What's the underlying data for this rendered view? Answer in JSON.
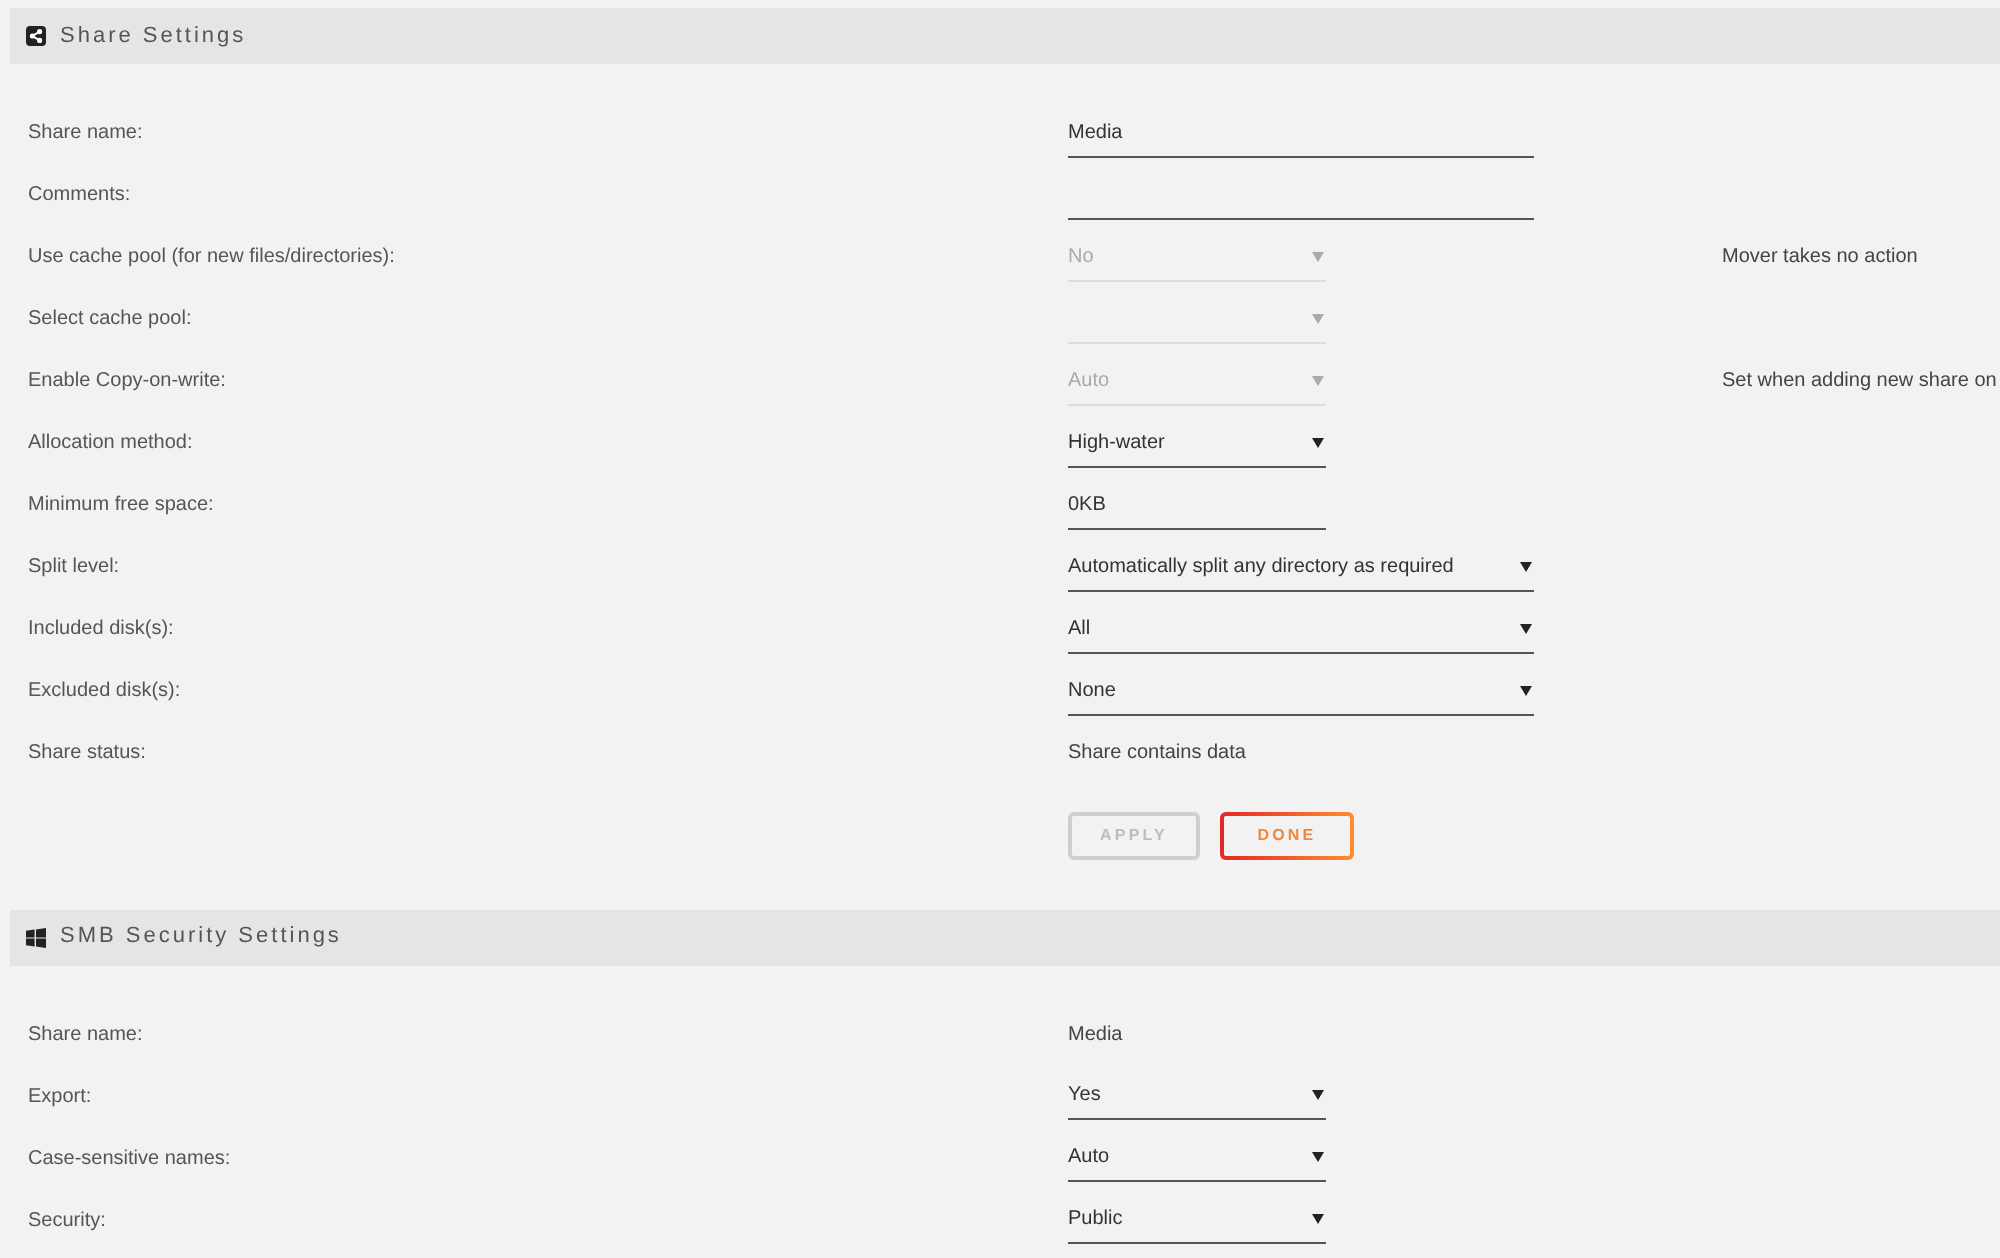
{
  "sections": [
    {
      "kind": "share",
      "title": "Share Settings",
      "rows": [
        {
          "label": "Share name:",
          "field": {
            "kind": "text",
            "value": "Media",
            "wide": true
          }
        },
        {
          "label": "Comments:",
          "field": {
            "kind": "text",
            "wide": true
          }
        },
        {
          "label": "Use cache pool (for new files/directories):",
          "field": {
            "kind": "select",
            "value": "No",
            "disabled": true,
            "wide": false
          },
          "note": "Mover takes no action"
        },
        {
          "label": "Select cache pool:",
          "field": {
            "kind": "select",
            "disabled": true,
            "wide": false
          }
        },
        {
          "label": "Enable Copy-on-write:",
          "field": {
            "kind": "select",
            "value": "Auto",
            "disabled": true,
            "wide": false
          },
          "note": "Set when adding new share on"
        },
        {
          "label": "Allocation method:",
          "field": {
            "kind": "select",
            "value": "High-water",
            "disabled": false,
            "wide": false
          }
        },
        {
          "label": "Minimum free space:",
          "field": {
            "kind": "text",
            "value": "0KB",
            "wide": false
          }
        },
        {
          "label": "Split level:",
          "field": {
            "kind": "select",
            "value": "Automatically split any directory as required",
            "disabled": false,
            "wide": true
          }
        },
        {
          "label": "Included disk(s):",
          "field": {
            "kind": "select",
            "value": "All",
            "disabled": false,
            "wide": true
          }
        },
        {
          "label": "Excluded disk(s):",
          "field": {
            "kind": "select",
            "value": "None",
            "disabled": false,
            "wide": true
          }
        },
        {
          "label": "Share status:",
          "field": {
            "kind": "static",
            "value": "Share contains data"
          }
        }
      ],
      "buttons": [
        {
          "label": "APPLY",
          "disabled": true
        },
        {
          "label": "DONE",
          "disabled": false
        }
      ]
    },
    {
      "kind": "smb",
      "title": "SMB Security Settings",
      "rows": [
        {
          "label": "Share name:",
          "field": {
            "kind": "static",
            "value": "Media"
          }
        },
        {
          "label": "Export:",
          "field": {
            "kind": "select",
            "value": "Yes",
            "disabled": false,
            "wide": false
          }
        },
        {
          "label": "Case-sensitive names:",
          "field": {
            "kind": "select",
            "value": "Auto",
            "disabled": false,
            "wide": false
          }
        },
        {
          "label": "Security:",
          "field": {
            "kind": "select",
            "value": "Public",
            "disabled": false,
            "wide": false
          }
        }
      ]
    }
  ]
}
